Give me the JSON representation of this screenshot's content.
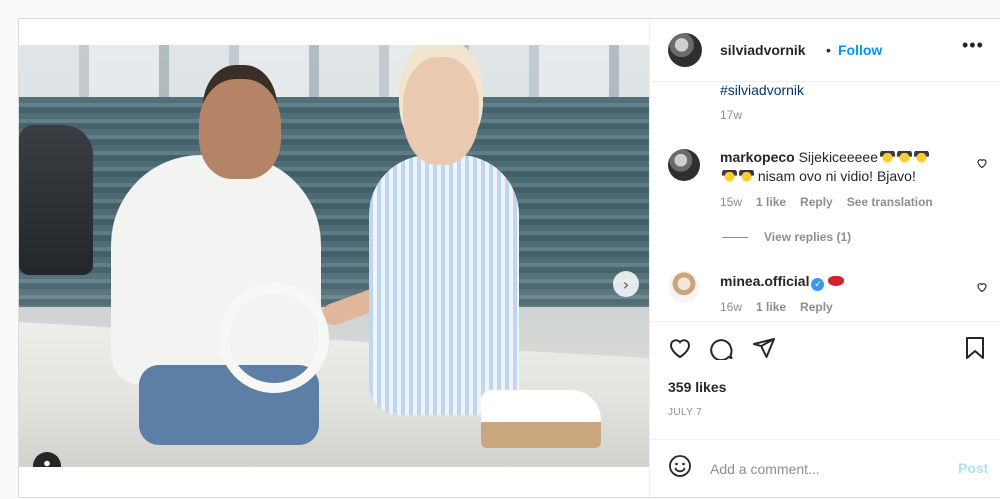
{
  "post": {
    "author": "silviadvornik",
    "separator": "•",
    "follow_label": "Follow",
    "more_glyph": "•••",
    "caption_hashtag": "#silviadvornik",
    "caption_time": "17w",
    "carousel": {
      "current_index": 1,
      "total": 3
    }
  },
  "comments": [
    {
      "user": "markopeco",
      "text_line1": "Sijekiceeeee",
      "text_line2": "nisam ovo ni vidio! Bjavo!",
      "time": "15w",
      "likes": "1 like",
      "reply_label": "Reply",
      "translate_label": "See translation",
      "view_replies": "View replies (1)"
    },
    {
      "user": "minea.official",
      "verified": true,
      "time": "16w",
      "likes": "1 like",
      "reply_label": "Reply"
    }
  ],
  "stats": {
    "likes": "359 likes",
    "date": "JULY 7"
  },
  "add_comment": {
    "placeholder": "Add a comment...",
    "post_label": "Post"
  },
  "colors": {
    "accent": "#0095f6",
    "text": "#262626",
    "muted": "#8e8e8e",
    "post_disabled": "#b2dffc"
  },
  "icons": [
    "next-arrow-icon",
    "tag-people-icon",
    "more-options-icon",
    "heart-icon",
    "comment-icon",
    "share-icon",
    "save-icon",
    "emoji-icon",
    "verified-icon"
  ]
}
